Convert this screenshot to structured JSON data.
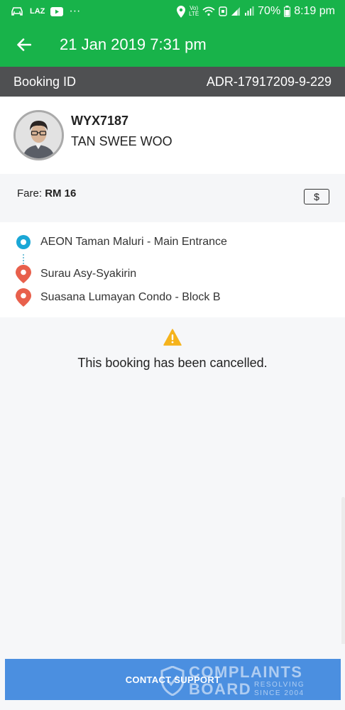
{
  "status_bar": {
    "carrier": "LAZ",
    "overflow": "···",
    "volte": "Vo)",
    "lte": "LTE",
    "battery": "70%",
    "time": "8:19 pm"
  },
  "header": {
    "title": "21 Jan 2019 7:31 pm"
  },
  "booking": {
    "label": "Booking ID",
    "id": "ADR-17917209-9-229"
  },
  "driver": {
    "plate": "WYX7187",
    "name": "TAN SWEE WOO"
  },
  "fare": {
    "label": "Fare:",
    "amount": "RM 16",
    "payment_icon": "$"
  },
  "route": {
    "stops": [
      {
        "label": "AEON Taman Maluri - Main Entrance",
        "icon": "pickup-icon"
      },
      {
        "label": "Surau Asy-Syakirin",
        "icon": "location-pin-icon"
      },
      {
        "label": "Suasana Lumayan Condo - Block B",
        "icon": "location-pin-icon"
      }
    ]
  },
  "cancel": {
    "message": "This booking has been cancelled."
  },
  "footer": {
    "contact_label": "CONTACT SUPPORT"
  },
  "watermark": {
    "line1": "COMPLAINTS",
    "line2": "BOARD",
    "line3": "RESOLVING",
    "line4": "SINCE 2004"
  },
  "colors": {
    "brand_green": "#18b34a",
    "booking_bar": "#4f5052",
    "pickup_blue": "#1aa7d6",
    "pin_red": "#e8604c",
    "warning_yellow": "#f5b31c",
    "button_blue": "#4b8fe0"
  }
}
